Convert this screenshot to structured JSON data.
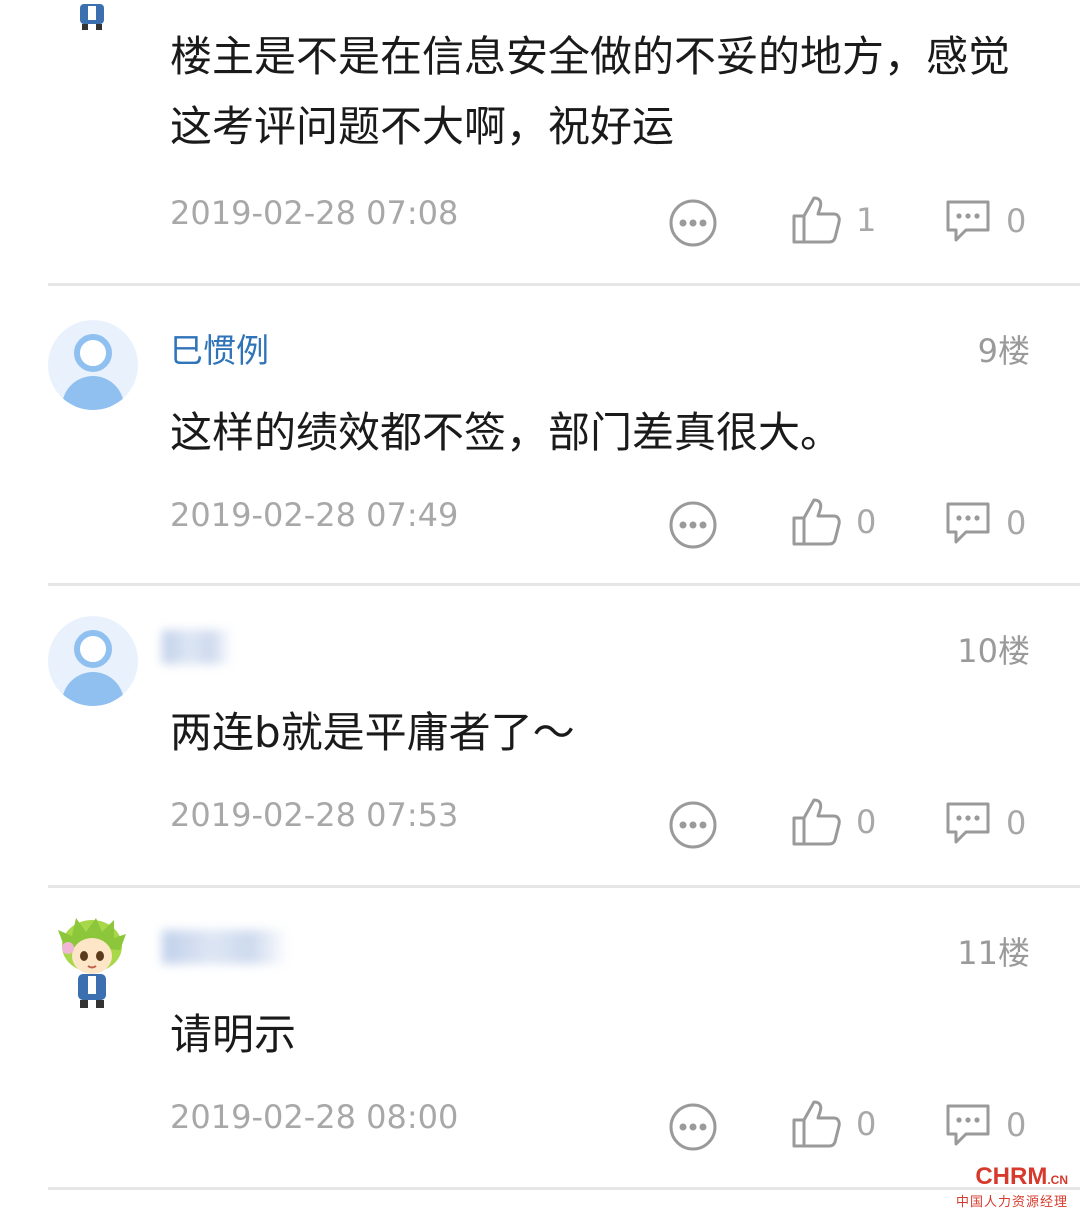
{
  "comments": [
    {
      "username": "",
      "floor": "",
      "content": "楼主是不是在信息安全做的不妥的地方，感觉这考评问题不大啊，祝好运",
      "timestamp": "2019-02-28 07:08",
      "likes": "1",
      "replies": "0",
      "avatar": "anime-avatar"
    },
    {
      "username": "巳惯例",
      "floor": "9楼",
      "content": "这样的绩效都不签，部门差真很大。",
      "timestamp": "2019-02-28 07:49",
      "likes": "0",
      "replies": "0",
      "avatar": "default-avatar"
    },
    {
      "username": "",
      "floor": "10楼",
      "content": "两连b就是平庸者了～",
      "timestamp": "2019-02-28 07:53",
      "likes": "0",
      "replies": "0",
      "avatar": "default-avatar"
    },
    {
      "username": "",
      "floor": "11楼",
      "content": "请明示",
      "timestamp": "2019-02-28 08:00",
      "likes": "0",
      "replies": "0",
      "avatar": "anime-avatar"
    }
  ],
  "icons": {
    "more": "more-icon",
    "like": "thumbs-up-icon",
    "reply": "comment-icon"
  },
  "colors": {
    "username": "#2f73b8",
    "meta": "#a8a8a8",
    "watermark": "#d63a2d"
  },
  "watermark": {
    "brand": "CHRM",
    "suffix": ".CN",
    "tagline": "中国人力资源经理"
  }
}
